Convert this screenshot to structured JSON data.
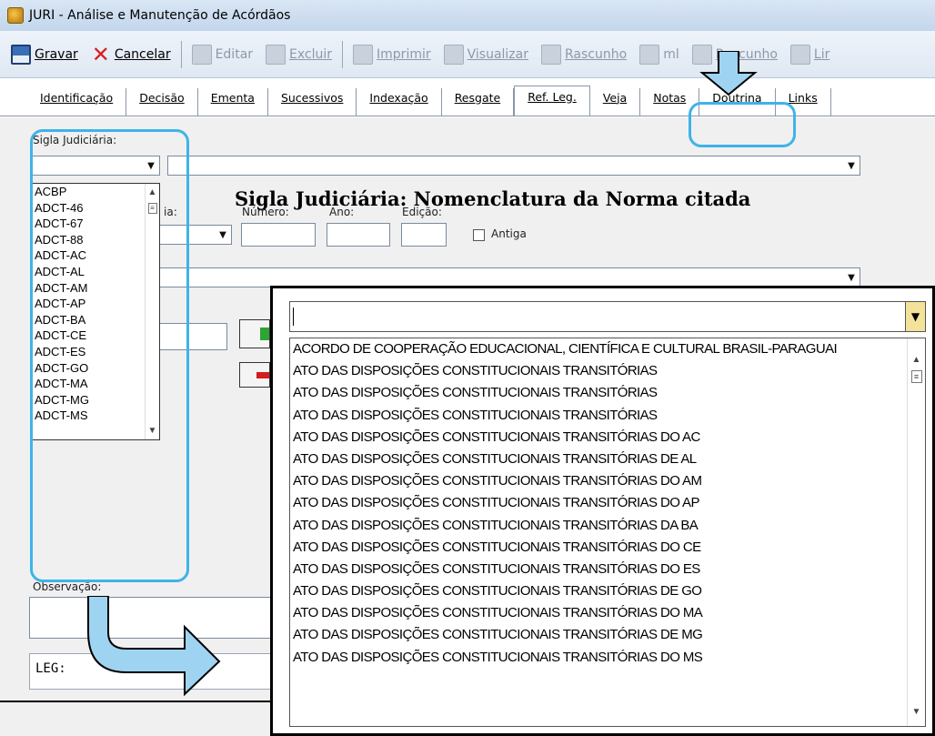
{
  "window": {
    "title": "JURI - Análise e Manutenção de Acórdãos"
  },
  "toolbar": {
    "buttons": [
      {
        "label": "Gravar",
        "icon": "floppy-icon",
        "enabled": true
      },
      {
        "label": "Cancelar",
        "icon": "cancel-x-icon",
        "enabled": true
      },
      {
        "label": "Editar",
        "icon": "edit-icon",
        "enabled": false
      },
      {
        "label": "Excluir",
        "icon": "delete-icon",
        "enabled": false
      },
      {
        "label": "Imprimir",
        "icon": "print-icon",
        "enabled": false
      },
      {
        "label": "Visualizar",
        "icon": "preview-icon",
        "enabled": false
      },
      {
        "label": "Rascunho",
        "icon": "draft-icon",
        "enabled": false
      },
      {
        "label": "ml",
        "icon": "html-icon",
        "enabled": false
      },
      {
        "label": "Rascunho",
        "icon": "tmp-draft-icon",
        "enabled": false
      },
      {
        "label": "Lir",
        "icon": "clean-icon",
        "enabled": false
      }
    ]
  },
  "tabs": [
    "Identificação",
    "Decisão",
    "Ementa",
    "Sucessivos",
    "Indexação",
    "Resgate",
    "Ref. Leg.",
    "Veja",
    "Notas",
    "Doutrina",
    "Links"
  ],
  "active_tab": "Ref. Leg.",
  "form": {
    "sigla_label": "Sigla Judiciária:",
    "norma_label": "ia:",
    "numero_label": "Número:",
    "ano_label": "Ano:",
    "edicao_label": "Edição:",
    "antiga_label": "Antiga",
    "observacao_label": "Observação:",
    "leg_prefix": "LEG:"
  },
  "sigla_list": [
    "ACBP",
    "ADCT-46",
    "ADCT-67",
    "ADCT-88",
    "ADCT-AC",
    "ADCT-AL",
    "ADCT-AM",
    "ADCT-AP",
    "ADCT-BA",
    "ADCT-CE",
    "ADCT-ES",
    "ADCT-GO",
    "ADCT-MA",
    "ADCT-MG",
    "ADCT-MS"
  ],
  "callout": {
    "title": "Sigla Judiciária: Nomenclatura da Norma citada"
  },
  "norma_list": [
    "ACORDO DE COOPERAÇÃO EDUCACIONAL, CIENTÍFICA E CULTURAL BRASIL-PARAGUAI",
    "ATO DAS DISPOSIÇÕES CONSTITUCIONAIS TRANSITÓRIAS",
    "ATO DAS DISPOSIÇÕES CONSTITUCIONAIS TRANSITÓRIAS",
    "ATO DAS DISPOSIÇÕES CONSTITUCIONAIS TRANSITÓRIAS",
    "ATO DAS DISPOSIÇÕES CONSTITUCIONAIS TRANSITÓRIAS DO AC",
    "ATO DAS DISPOSIÇÕES CONSTITUCIONAIS TRANSITÓRIAS DE AL",
    "ATO DAS DISPOSIÇÕES CONSTITUCIONAIS TRANSITÓRIAS DO AM",
    "ATO DAS DISPOSIÇÕES CONSTITUCIONAIS TRANSITÓRIAS DO AP",
    "ATO DAS DISPOSIÇÕES CONSTITUCIONAIS TRANSITÓRIAS DA BA",
    "ATO DAS DISPOSIÇÕES CONSTITUCIONAIS TRANSITÓRIAS DO CE",
    "ATO DAS DISPOSIÇÕES CONSTITUCIONAIS TRANSITÓRIAS DO ES",
    "ATO DAS DISPOSIÇÕES CONSTITUCIONAIS TRANSITÓRIAS DE GO",
    "ATO DAS DISPOSIÇÕES CONSTITUCIONAIS TRANSITÓRIAS DO MA",
    "ATO DAS DISPOSIÇÕES CONSTITUCIONAIS TRANSITÓRIAS DE MG",
    "ATO DAS DISPOSIÇÕES CONSTITUCIONAIS TRANSITÓRIAS DO MS"
  ],
  "colors": {
    "highlight": "#3fb3e8",
    "arrow_fill": "#9fd3f2",
    "popup_arrow_bg": "#f2e29a"
  }
}
